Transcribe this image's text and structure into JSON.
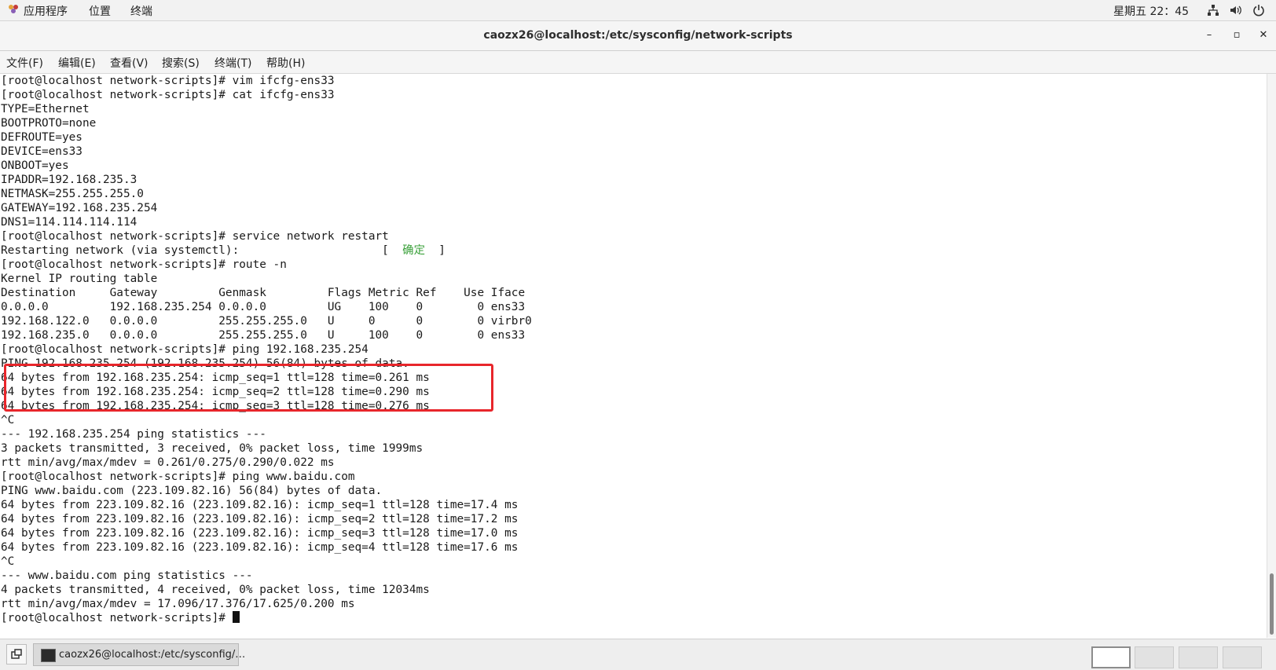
{
  "top_panel": {
    "applications": "应用程序",
    "places": "位置",
    "terminal": "终端",
    "clock": "星期五 22：45"
  },
  "window": {
    "title": "caozx26@localhost:/etc/sysconfig/network-scripts",
    "minimize": "–",
    "maximize": "▫",
    "close": "✕"
  },
  "menu": [
    "文件(F)",
    "编辑(E)",
    "查看(V)",
    "搜索(S)",
    "终端(T)",
    "帮助(H)"
  ],
  "terminal": {
    "lines": [
      "[root@localhost network-scripts]# vim ifcfg-ens33",
      "[root@localhost network-scripts]# cat ifcfg-ens33",
      "TYPE=Ethernet",
      "BOOTPROTO=none",
      "DEFROUTE=yes",
      "DEVICE=ens33",
      "ONBOOT=yes",
      "IPADDR=192.168.235.3",
      "NETMASK=255.255.255.0",
      "GATEWAY=192.168.235.254",
      "DNS1=114.114.114.114",
      "[root@localhost network-scripts]# service network restart",
      "Restarting network (via systemctl):                     [  ",
      "[root@localhost network-scripts]# route -n",
      "Kernel IP routing table",
      "Destination     Gateway         Genmask         Flags Metric Ref    Use Iface",
      "0.0.0.0         192.168.235.254 0.0.0.0         UG    100    0        0 ens33",
      "192.168.122.0   0.0.0.0         255.255.255.0   U     0      0        0 virbr0",
      "192.168.235.0   0.0.0.0         255.255.255.0   U     100    0        0 ens33",
      "[root@localhost network-scripts]# ping 192.168.235.254",
      "PING 192.168.235.254 (192.168.235.254) 56(84) bytes of data.",
      "64 bytes from 192.168.235.254: icmp_seq=1 ttl=128 time=0.261 ms",
      "64 bytes from 192.168.235.254: icmp_seq=2 ttl=128 time=0.290 ms",
      "64 bytes from 192.168.235.254: icmp_seq=3 ttl=128 time=0.276 ms",
      "^C",
      "--- 192.168.235.254 ping statistics ---",
      "3 packets transmitted, 3 received, 0% packet loss, time 1999ms",
      "rtt min/avg/max/mdev = 0.261/0.275/0.290/0.022 ms",
      "[root@localhost network-scripts]# ping www.baidu.com",
      "PING www.baidu.com (223.109.82.16) 56(84) bytes of data.",
      "64 bytes from 223.109.82.16 (223.109.82.16): icmp_seq=1 ttl=128 time=17.4 ms",
      "64 bytes from 223.109.82.16 (223.109.82.16): icmp_seq=2 ttl=128 time=17.2 ms",
      "64 bytes from 223.109.82.16 (223.109.82.16): icmp_seq=3 ttl=128 time=17.0 ms",
      "64 bytes from 223.109.82.16 (223.109.82.16): icmp_seq=4 ttl=128 time=17.6 ms",
      "^C",
      "--- www.baidu.com ping statistics ---",
      "4 packets transmitted, 4 received, 0% packet loss, time 12034ms",
      "rtt min/avg/max/mdev = 17.096/17.376/17.625/0.200 ms",
      "[root@localhost network-scripts]# "
    ],
    "ok_label": "确定",
    "ok_close": "  ]"
  },
  "taskbar": {
    "task_label": "caozx26@localhost:/etc/sysconfig/…"
  },
  "colors": {
    "ok_green": "#3aa03a",
    "highlight_red": "#e8262b"
  }
}
